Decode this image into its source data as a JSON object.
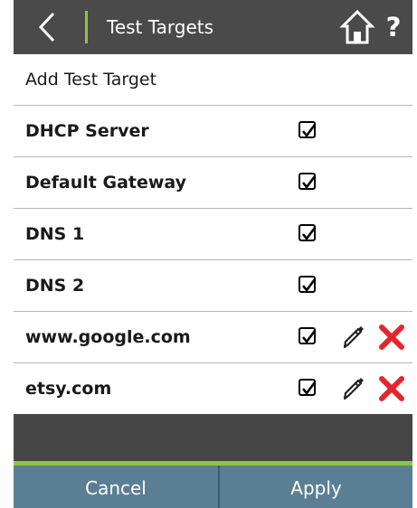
{
  "header": {
    "title": "Test Targets",
    "back_icon": "chevron-left-icon",
    "home_icon": "home-icon",
    "help_label": "?"
  },
  "colors": {
    "header_bg": "#4a4a4a",
    "accent_green": "#8dc63f",
    "footer_bg": "#5a7f94",
    "delete_red": "#e3262e"
  },
  "list": {
    "add_label": "Add Test Target",
    "rows": [
      {
        "label": "DHCP Server",
        "checked": true,
        "editable": false
      },
      {
        "label": "Default Gateway",
        "checked": true,
        "editable": false
      },
      {
        "label": "DNS 1",
        "checked": true,
        "editable": false
      },
      {
        "label": "DNS 2",
        "checked": true,
        "editable": false
      },
      {
        "label": "www.google.com",
        "checked": true,
        "editable": true
      },
      {
        "label": "etsy.com",
        "checked": true,
        "editable": true
      }
    ]
  },
  "footer": {
    "cancel_label": "Cancel",
    "apply_label": "Apply"
  }
}
